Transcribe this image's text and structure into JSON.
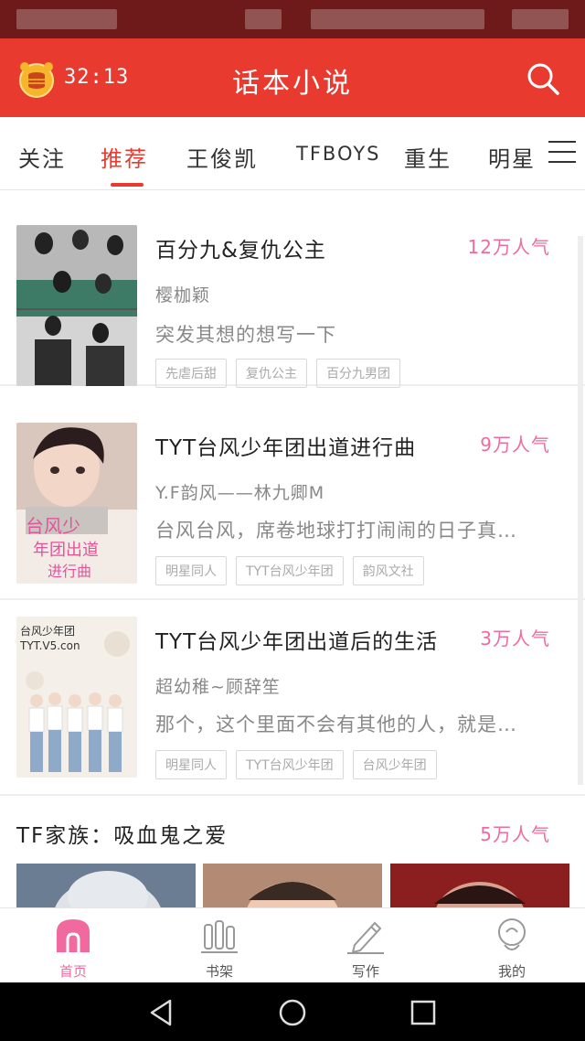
{
  "header": {
    "timer": "32:13",
    "title": "话本小说"
  },
  "tabs": [
    {
      "label": "关注"
    },
    {
      "label": "推荐"
    },
    {
      "label": "王俊凯"
    },
    {
      "label": "TFBOYS"
    },
    {
      "label": "重生"
    },
    {
      "label": "明星"
    }
  ],
  "books": [
    {
      "title": "百分九&复仇公主",
      "popularity": "12万人气",
      "author": "樱枷颖",
      "description": "突发其想的想写一下",
      "tags": [
        "先虐后甜",
        "复仇公主",
        "百分九男团"
      ]
    },
    {
      "title": "TYT台风少年团出道进行曲",
      "popularity": "9万人气",
      "author": "Y.F韵风——林九卿M",
      "description": "台风台风，席卷地球打打闹闹的日子真…",
      "tags": [
        "明星同人",
        "TYT台风少年团",
        "韵风文社"
      ]
    },
    {
      "title": "TYT台风少年团出道后的生活",
      "popularity": "3万人气",
      "author": "超幼稚~顾辞笙",
      "description": "那个，这个里面不会有其他的人，就是…",
      "tags": [
        "明星同人",
        "TYT台风少年团",
        "台风少年团"
      ]
    }
  ],
  "section": {
    "title": "TF家族：吸血鬼之爱",
    "popularity": "5万人气"
  },
  "bottom_nav": [
    {
      "label": "首页",
      "icon": "home-icon",
      "active": true
    },
    {
      "label": "书架",
      "icon": "bookshelf-icon",
      "active": false
    },
    {
      "label": "写作",
      "icon": "pencil-icon",
      "active": false
    },
    {
      "label": "我的",
      "icon": "profile-icon",
      "active": false
    }
  ],
  "colors": {
    "accent": "#e83a2e",
    "popularity": "#f06aa0",
    "status_bar": "#6e1a1a"
  }
}
